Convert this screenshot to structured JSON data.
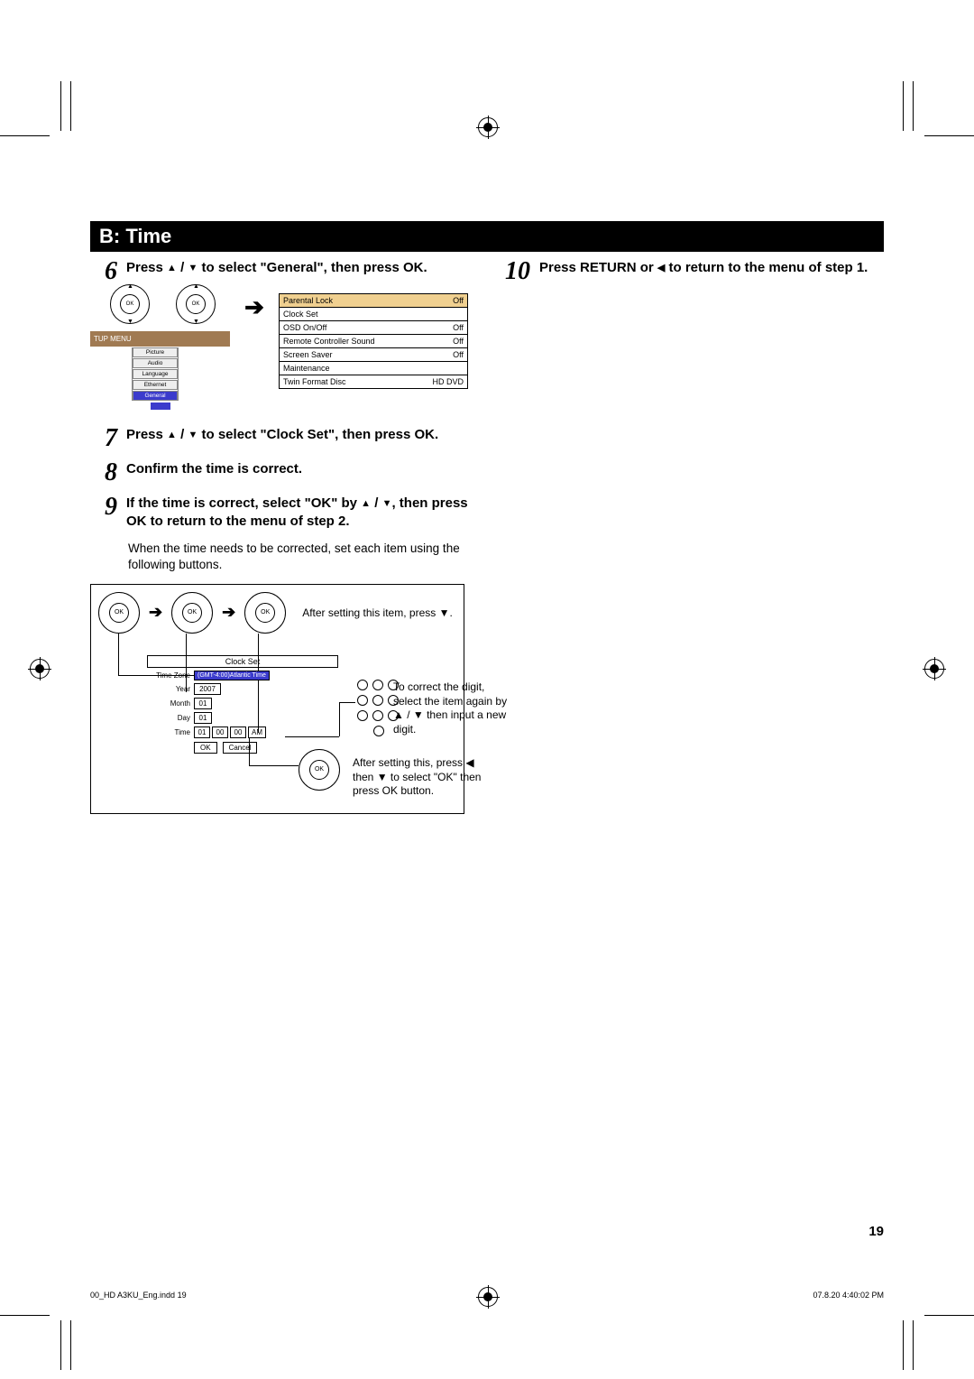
{
  "section_title": "B: Time",
  "steps": {
    "s6": {
      "num": "6",
      "text_a": "Press ",
      "text_b": " to select \"General\", then press OK."
    },
    "s7": {
      "num": "7",
      "text_a": "Press ",
      "text_b": " to select \"Clock Set\", then press OK."
    },
    "s8": {
      "num": "8",
      "text": "Confirm the time is correct."
    },
    "s9": {
      "num": "9",
      "text_a": "If the time is correct, select \"OK\" by ",
      "text_b": ", then press OK to return to the menu of step 2."
    },
    "s10": {
      "num": "10",
      "text_a": "Press RETURN or ",
      "text_b": " to return to the menu of step 1."
    }
  },
  "body_after_9": "When the time needs to be corrected, set each item using the following buttons.",
  "arrows": {
    "up": "▲",
    "down": "▼",
    "left": "◀",
    "sep": " / "
  },
  "diagram1": {
    "setup_menu_label": "TUP MENU",
    "menu_items": [
      "Picture",
      "Audio",
      "Language",
      "Ethernet",
      "General"
    ],
    "settings": [
      {
        "label": "Parental Lock",
        "value": "Off"
      },
      {
        "label": "Clock Set",
        "value": ""
      },
      {
        "label": "OSD On/Off",
        "value": "Off"
      },
      {
        "label": "Remote Controller Sound",
        "value": "Off"
      },
      {
        "label": "Screen Saver",
        "value": "Off"
      },
      {
        "label": "Maintenance",
        "value": ""
      },
      {
        "label": "Twin Format Disc",
        "value": "HD DVD"
      }
    ],
    "ok": "OK"
  },
  "diagram2": {
    "after_setting_item": "After setting this item, press ▼.",
    "clock_title": "Clock Set",
    "rows": {
      "tz_label": "Time Zone",
      "tz_val": "(GMT-4:00)Atlantic Time",
      "year_label": "Year",
      "year_val": "2007",
      "month_label": "Month",
      "month_val": "01",
      "day_label": "Day",
      "day_val": "01",
      "time_label": "Time",
      "time_h": "01",
      "time_m": "00",
      "time_s": "00",
      "ampm": "AM"
    },
    "ok_btn": "OK",
    "cancel_btn": "Cancel",
    "ok": "OK",
    "note_digit": "To correct the digit, select the item again by ▲ / ▼ then input a new digit.",
    "note_after": "After setting this, press ◀ then ▼ to select \"OK\" then press OK button."
  },
  "page_number": "19",
  "footer": {
    "left": "00_HD A3KU_Eng.indd   19",
    "right": "07.8.20   4:40:02 PM"
  }
}
